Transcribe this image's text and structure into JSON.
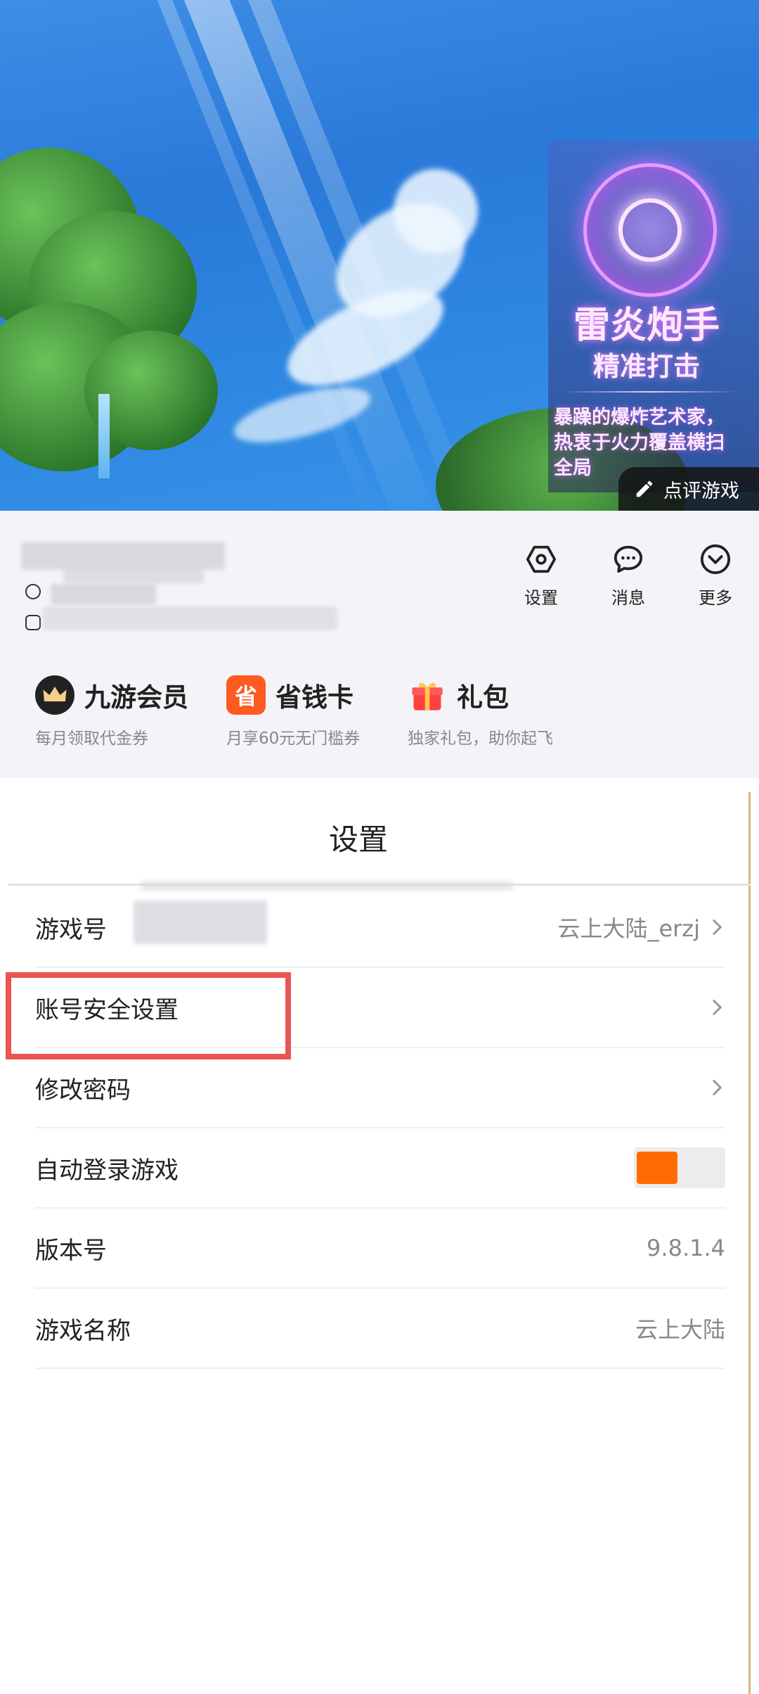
{
  "banner": {
    "skill_title": "雷炎炮手",
    "skill_subtitle": "精准打击",
    "skill_desc_lines": [
      "暴躁的爆炸艺术家，",
      "热衷于火力覆盖横扫",
      "全局"
    ],
    "review_label": "点评游戏",
    "review_icon": "pencil-icon"
  },
  "profile": {
    "actions": [
      {
        "label": "设置",
        "icon": "settings-hexagon-icon"
      },
      {
        "label": "消息",
        "icon": "chat-bubble-icon"
      },
      {
        "label": "更多",
        "icon": "chevron-down-circle-icon"
      }
    ],
    "perks": [
      {
        "title": "九游会员",
        "desc": "每月领取代金券",
        "icon": "crown-icon",
        "color": "#222222"
      },
      {
        "title": "省钱卡",
        "desc": "月享60元无门槛券",
        "icon": "save-card-icon",
        "color": "#ff5a1f"
      },
      {
        "title": "礼包",
        "desc": "独家礼包，助你起飞",
        "icon": "gift-icon",
        "color": "#ff4040"
      }
    ]
  },
  "settings": {
    "title": "设置",
    "rows": [
      {
        "label": "游戏号",
        "value": "云上大陆_erzj",
        "chevron": true
      },
      {
        "label": "账号安全设置",
        "value": "",
        "chevron": true
      },
      {
        "label": "修改密码",
        "value": "",
        "chevron": true
      },
      {
        "label": "自动登录游戏",
        "toggle_on": true
      },
      {
        "label": "版本号",
        "value": "9.8.1.4",
        "chevron": false
      },
      {
        "label": "游戏名称",
        "value": "云上大陆",
        "chevron": false
      }
    ]
  },
  "colors": {
    "accent": "#ff6b00",
    "highlight": "#e95552"
  }
}
